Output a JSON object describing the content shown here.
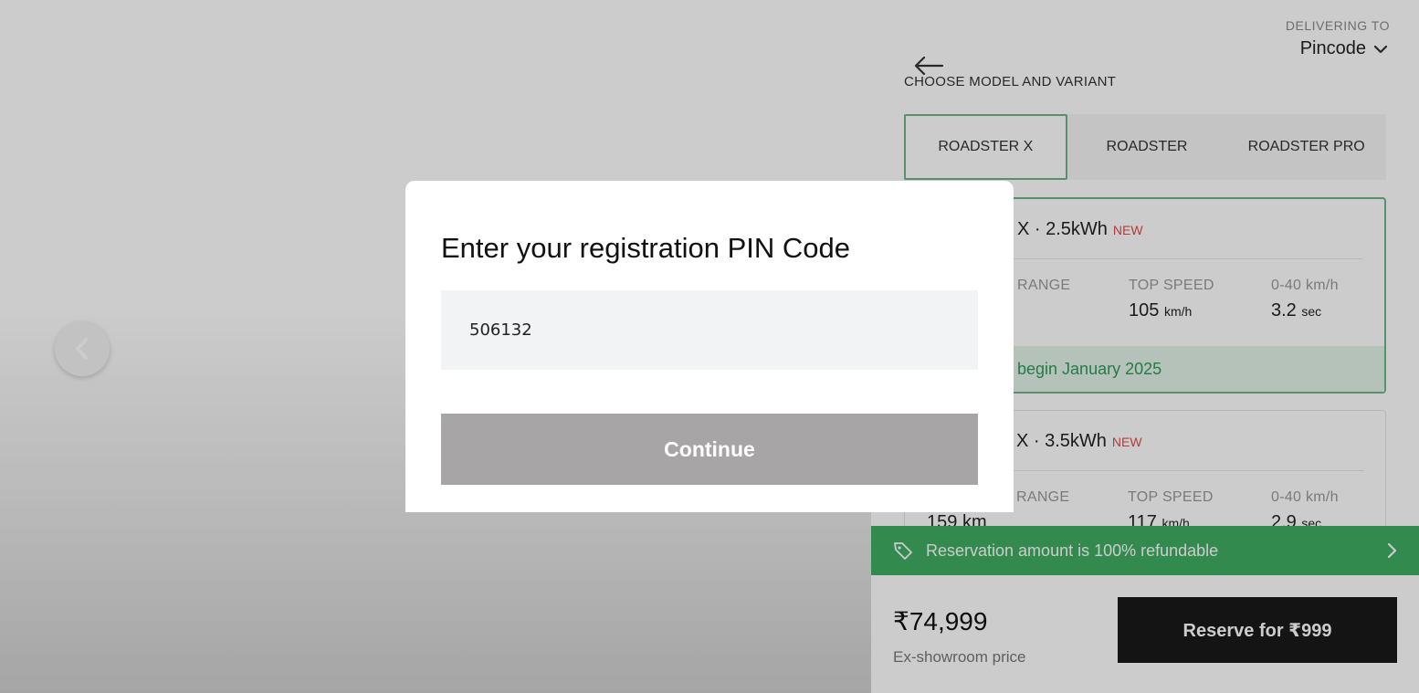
{
  "header": {
    "delivering_label": "DELIVERING TO",
    "pincode_label": "Pincode"
  },
  "section_title": "CHOOSE MODEL AND VARIANT",
  "model_tabs": [
    {
      "label": "ROADSTER X",
      "active": true
    },
    {
      "label": "ROADSTER",
      "active": false
    },
    {
      "label": "ROADSTER PRO",
      "active": false
    }
  ],
  "variants": [
    {
      "title": "X · 2.5kWh",
      "badge": "NEW",
      "specs": [
        {
          "label": "RANGE",
          "value": "",
          "unit": ""
        },
        {
          "label": "TOP SPEED",
          "value": "105",
          "unit": "km/h"
        },
        {
          "label": "0-40 km/h",
          "value": "3.2",
          "unit": "sec"
        }
      ],
      "notice": "begin January 2025"
    },
    {
      "title": "X · 3.5kWh",
      "badge": "NEW",
      "specs": [
        {
          "label": "RANGE",
          "value": "159",
          "unit": "km"
        },
        {
          "label": "TOP SPEED",
          "value": "117",
          "unit": "km/h"
        },
        {
          "label": "0-40 km/h",
          "value": "2.9",
          "unit": "sec"
        }
      ]
    }
  ],
  "refund_bar": {
    "text": "Reservation amount is 100% refundable"
  },
  "footer": {
    "price": "₹74,999",
    "price_sub": "Ex-showroom price",
    "reserve_label": "Reserve for ₹999"
  },
  "modal": {
    "title": "Enter your registration PIN Code",
    "pin_value": "506132",
    "continue_label": "Continue"
  },
  "colors": {
    "accent_green": "#3fad62",
    "new_badge": "#e24a4a",
    "button_disabled": "#a7a5a6"
  }
}
